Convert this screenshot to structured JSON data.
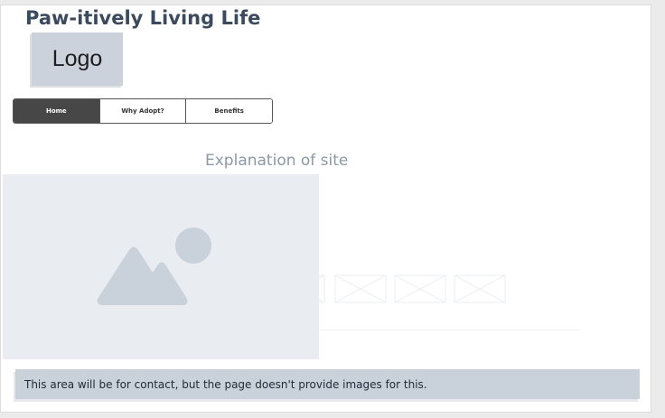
{
  "site": {
    "title": "Paw-itively Living Life",
    "logo_label": "Logo"
  },
  "nav": {
    "tabs": [
      {
        "label": "Home",
        "active": true
      },
      {
        "label": "Why Adopt?",
        "active": false
      },
      {
        "label": "Benefits",
        "active": false
      }
    ]
  },
  "main": {
    "explanation": "Explanation of site",
    "hero_icon": "image-placeholder-icon",
    "gallery_icon": "image-placeholder-icon"
  },
  "footer": {
    "contact_text": "This area will be for contact, but the page doesn't provide images for this."
  },
  "colors": {
    "placeholder_bg": "#e9edf2",
    "placeholder_icon": "#c9d1da",
    "nav_active": "#474747",
    "contact_bg": "#c9d1da"
  }
}
